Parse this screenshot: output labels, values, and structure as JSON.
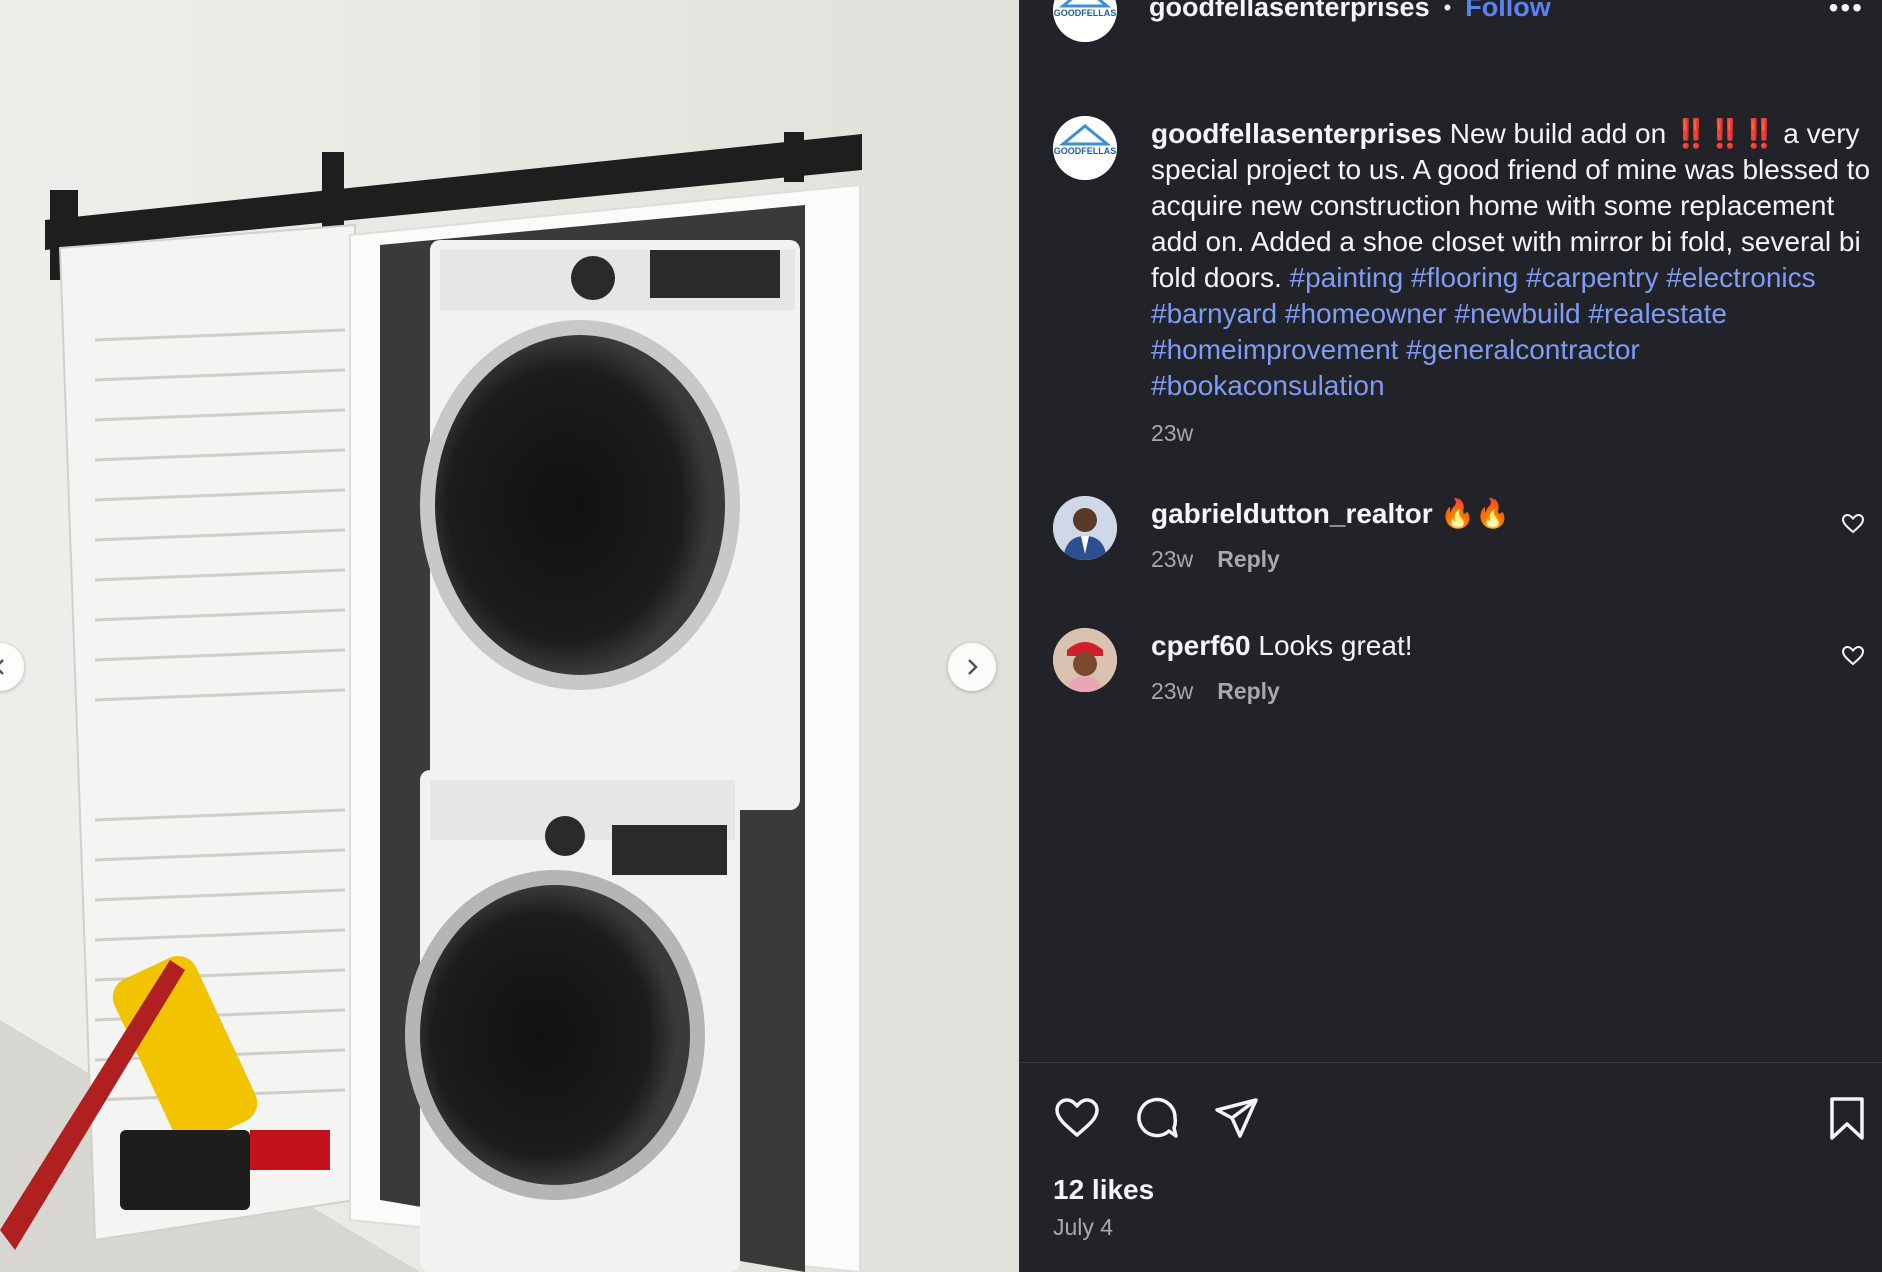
{
  "header": {
    "username": "goodfellasenterprises",
    "separator": "•",
    "follow_label": "Follow",
    "more_label": "•••",
    "avatar_logo_text": "GOODFELLAS"
  },
  "caption": {
    "username": "goodfellasenterprises",
    "text_before": "New build add on",
    "exclamations": "‼️‼️‼️",
    "text_after": "a very special project to us. A good friend of mine was blessed to acquire new construction home with some replacement add on. Added a shoe closet with mirror bi fold, several bi fold doors.",
    "hashtags": [
      "#painting",
      "#flooring",
      "#carpentry",
      "#electronics",
      "#barnyard",
      "#homeowner",
      "#newbuild",
      "#realestate",
      "#homeimprovement",
      "#generalcontractor",
      "#bookaconsulation"
    ],
    "time": "23w"
  },
  "comments": [
    {
      "username": "gabrieldutton_realtor",
      "text": "🔥🔥",
      "time": "23w",
      "reply_label": "Reply"
    },
    {
      "username": "cperf60",
      "text": "Looks great!",
      "time": "23w",
      "reply_label": "Reply"
    }
  ],
  "footer": {
    "likes": "12 likes",
    "date": "July 4"
  },
  "colors": {
    "panel_bg": "#212328",
    "link_blue": "#5b82f5",
    "hashtag_blue": "#7f9bf3",
    "muted_text": "#a8a8a8"
  },
  "icons": [
    "chevron-right-icon",
    "heart-icon",
    "comment-icon",
    "share-icon",
    "bookmark-icon",
    "more-icon"
  ]
}
